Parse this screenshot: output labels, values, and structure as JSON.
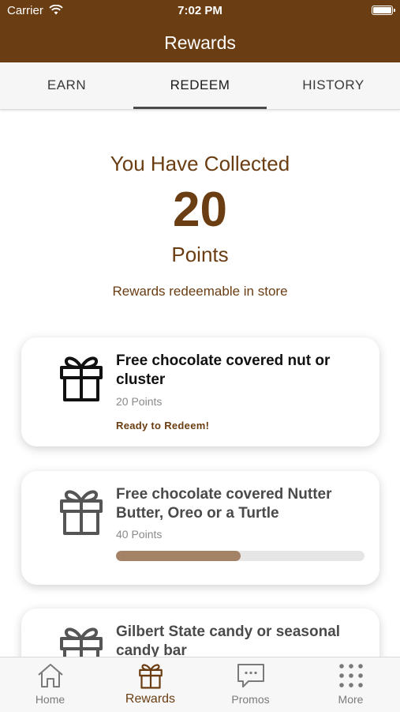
{
  "status_bar": {
    "carrier": "Carrier",
    "time": "7:02 PM"
  },
  "header": {
    "title": "Rewards"
  },
  "tabs": [
    {
      "label": "EARN",
      "active": false
    },
    {
      "label": "REDEEM",
      "active": true
    },
    {
      "label": "HISTORY",
      "active": false
    }
  ],
  "summary": {
    "collected_label": "You Have Collected",
    "points_value": "20",
    "points_unit": "Points",
    "note": "Rewards redeemable in store"
  },
  "rewards": [
    {
      "title": "Free chocolate covered nut or cluster",
      "points": "20 Points",
      "status": "Ready to Redeem!",
      "icon": "gift-icon"
    },
    {
      "title": "Free chocolate covered Nutter Butter, Oreo or a Turtle",
      "points": "40 Points",
      "progress": 0.5,
      "icon": "gift-icon"
    },
    {
      "title": "Gilbert State candy or seasonal candy bar",
      "icon": "gift-icon"
    }
  ],
  "tabbar": [
    {
      "label": "Home",
      "icon": "home-icon",
      "active": false
    },
    {
      "label": "Rewards",
      "icon": "gift-icon",
      "active": true
    },
    {
      "label": "Promos",
      "icon": "chat-bubble-icon",
      "active": false
    },
    {
      "label": "More",
      "icon": "grid-dots-icon",
      "active": false
    }
  ],
  "colors": {
    "brand_brown": "#6b3d12",
    "progress_fill": "#a48266",
    "progress_track": "#e6e6e6"
  }
}
